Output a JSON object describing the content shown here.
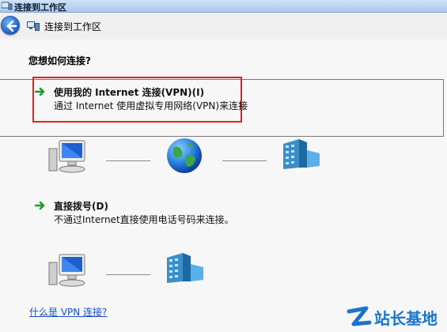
{
  "window": {
    "title": "连接到工作区"
  },
  "header": {
    "title": "连接到工作区"
  },
  "question": "您想如何连接?",
  "options": [
    {
      "title": "使用我的 Internet 连接(VPN)(I)",
      "description": "通过 Internet 使用虚拟专用网络(VPN)来连接"
    },
    {
      "title": "直接拨号(D)",
      "description": "不通过Internet直接使用电话号码来连接。"
    }
  ],
  "help_link": "什么是 VPN 连接?",
  "watermark": "站长基地",
  "colors": {
    "highlight": "#e02020",
    "link": "#1a4fc4",
    "arrow": "#1f9a2a"
  }
}
